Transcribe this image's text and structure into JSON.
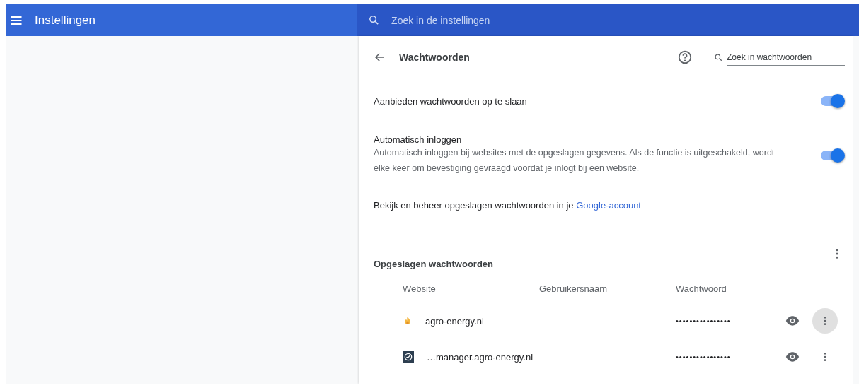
{
  "header": {
    "title": "Instellingen",
    "search": {
      "placeholder": "Zoek in de instellingen"
    }
  },
  "page": {
    "title": "Wachtwoorden",
    "search": {
      "placeholder": "Zoek in wachtwoorden"
    }
  },
  "settings": [
    {
      "kind": "toggle",
      "label": "Aanbieden wachtwoorden op te slaan",
      "on": true
    },
    {
      "kind": "toggle",
      "label": "Automatisch inloggen",
      "description": "Automatisch inloggen bij websites met de opgeslagen gegevens. Als de functie is uitgeschakeld, wordt elke keer om bevestiging gevraagd voordat je inlogt bij een website.",
      "on": true
    },
    {
      "kind": "link",
      "text": "Bekijk en beheer opgeslagen wachtwoorden in je ",
      "link": "Google-account"
    }
  ],
  "saved": {
    "title": "Opgeslagen wachtwoorden",
    "columns": [
      "Website",
      "Gebruikersnaam",
      "Wachtwoord"
    ],
    "rows": [
      {
        "website": "agro-energy.nl",
        "password": "••••••••••••••••",
        "highlighted": true
      },
      {
        "website": "…manager.agro-energy.nl",
        "password": "••••••••••••••••",
        "highlighted": false
      }
    ]
  }
}
